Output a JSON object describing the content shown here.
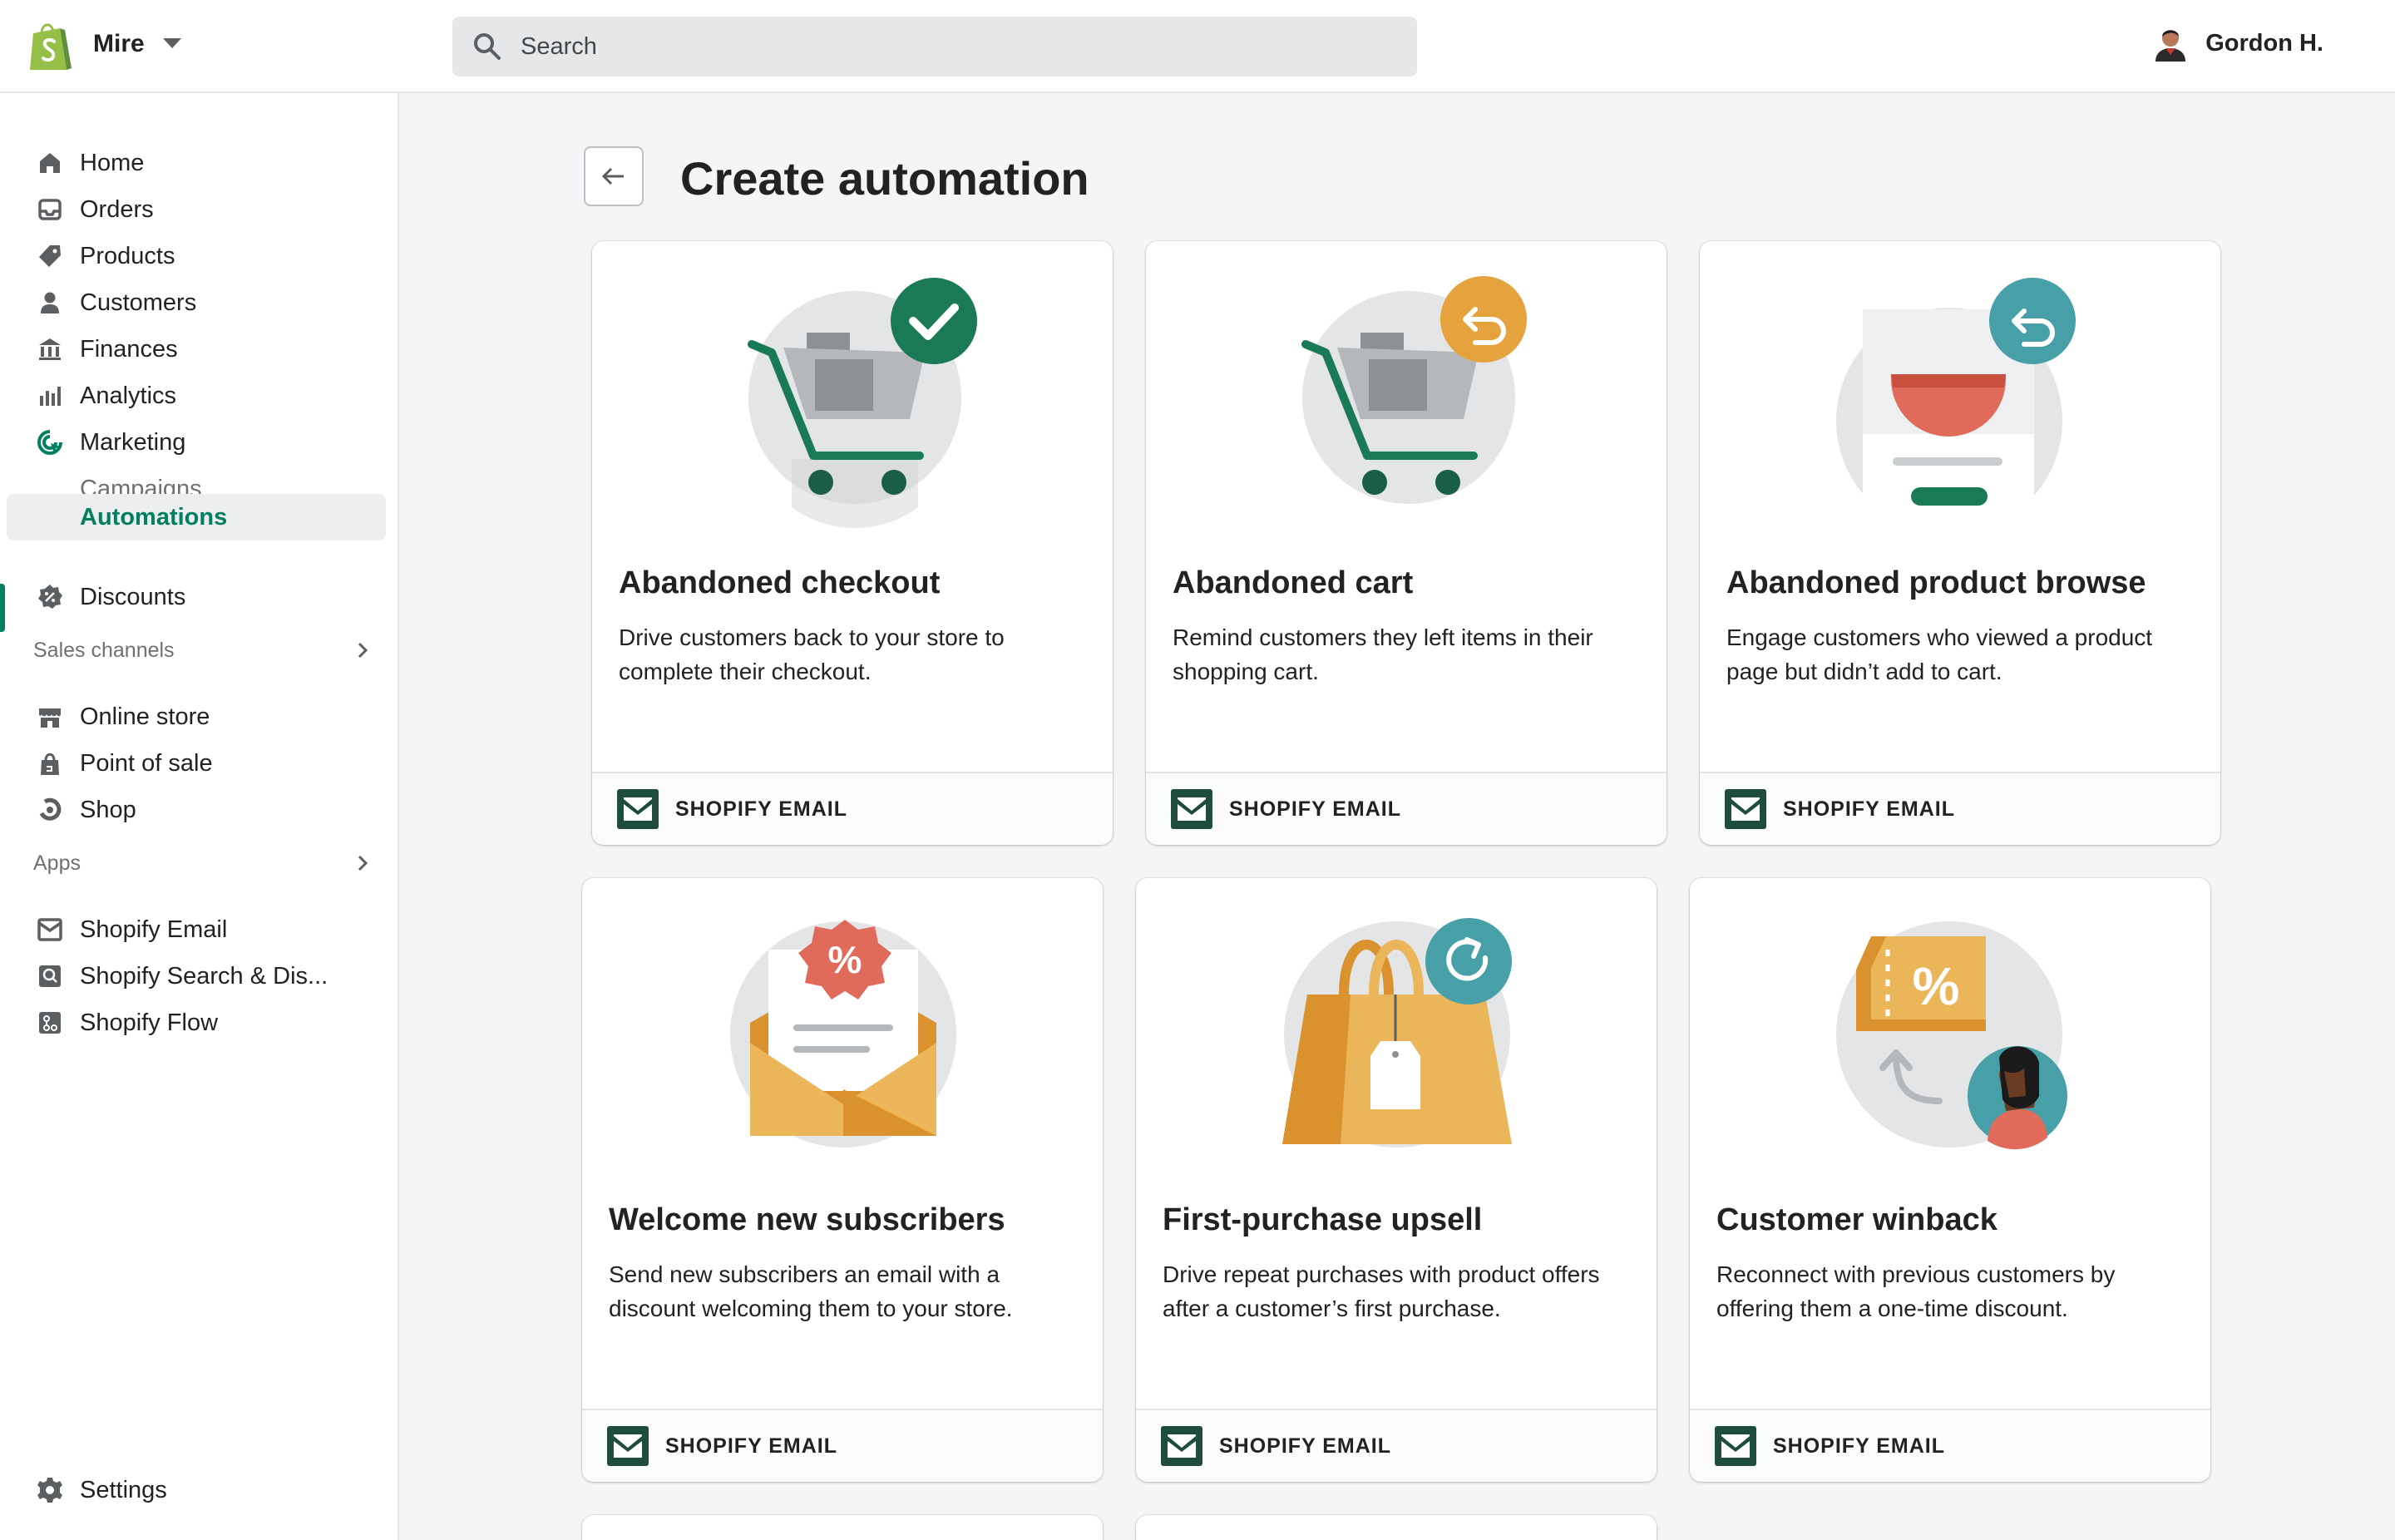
{
  "topbar": {
    "store_name": "Mire",
    "search_placeholder": "Search",
    "user_name": "Gordon H."
  },
  "sidebar": {
    "items": [
      {
        "label": "Home",
        "icon": "home-icon"
      },
      {
        "label": "Orders",
        "icon": "orders-icon"
      },
      {
        "label": "Products",
        "icon": "tag-icon"
      },
      {
        "label": "Customers",
        "icon": "person-icon"
      },
      {
        "label": "Finances",
        "icon": "bank-icon"
      },
      {
        "label": "Analytics",
        "icon": "bar-chart-icon"
      },
      {
        "label": "Marketing",
        "icon": "marketing-icon"
      },
      {
        "label": "Campaigns"
      },
      {
        "label": "Automations"
      },
      {
        "label": "Discounts",
        "icon": "discount-icon"
      }
    ],
    "sales_channels": {
      "heading": "Sales channels",
      "items": [
        {
          "label": "Online store",
          "icon": "store-icon"
        },
        {
          "label": "Point of sale",
          "icon": "shopping-bag-icon"
        },
        {
          "label": "Shop",
          "icon": "shop-app-icon"
        }
      ]
    },
    "apps": {
      "heading": "Apps",
      "items": [
        {
          "label": "Shopify Email",
          "icon": "email-icon"
        },
        {
          "label": "Shopify Search & Dis...",
          "icon": "search-discovery-icon"
        },
        {
          "label": "Shopify Flow",
          "icon": "flow-icon"
        }
      ]
    },
    "settings": {
      "label": "Settings",
      "icon": "gear-icon"
    }
  },
  "main": {
    "title": "Create automation",
    "cards": [
      {
        "title": "Abandoned checkout",
        "description": "Drive customers back to your store to complete their checkout.",
        "footer": "SHOPIFY EMAIL"
      },
      {
        "title": "Abandoned cart",
        "description": "Remind customers they left items in their shopping cart.",
        "footer": "SHOPIFY EMAIL"
      },
      {
        "title": "Abandoned product browse",
        "description": "Engage customers who viewed a product page but didn’t add to cart.",
        "footer": "SHOPIFY EMAIL"
      },
      {
        "title": "Welcome new subscribers",
        "description": "Send new subscribers an email with a discount welcoming them to your store.",
        "footer": "SHOPIFY EMAIL"
      },
      {
        "title": "First-purchase upsell",
        "description": "Drive repeat purchases with product offers after a customer’s first purchase.",
        "footer": "SHOPIFY EMAIL"
      },
      {
        "title": "Customer winback",
        "description": "Reconnect with previous customers by offering them a one-time discount.",
        "footer": "SHOPIFY EMAIL"
      }
    ]
  },
  "colors": {
    "accent": "#008060",
    "email_icon": "#1e4d3c",
    "orange": "#e6a23c",
    "teal": "#47a0a8",
    "coral": "#e06b5b"
  }
}
